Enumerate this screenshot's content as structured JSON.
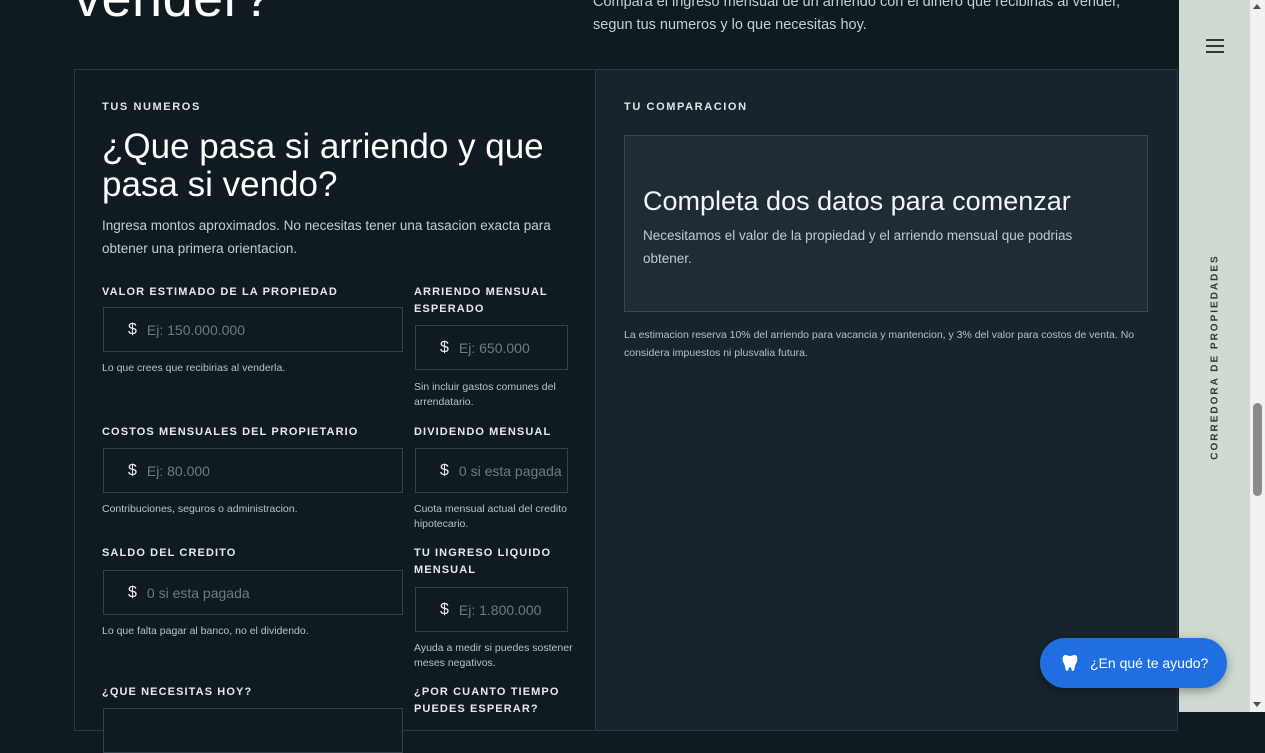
{
  "hero": {
    "title_fragment": "vender?",
    "subtitle": "Compara el ingreso mensual de un arriendo con el dinero que recibirias al vender, segun tus numeros y lo que necesitas hoy."
  },
  "form": {
    "eyebrow": "TUS NUMEROS",
    "title": "¿Que pasa si arriendo y que pasa si vendo?",
    "intro": "Ingresa montos aproximados. No necesitas tener una tasacion exacta para obtener una primera orientacion.",
    "currency_symbol": "$",
    "fields": [
      {
        "label": "VALOR ESTIMADO DE LA PROPIEDAD",
        "placeholder": "Ej: 150.000.000",
        "help": "Lo que crees que recibirias al venderla."
      },
      {
        "label": "ARRIENDO MENSUAL ESPERADO",
        "placeholder": "Ej: 650.000",
        "help": "Sin incluir gastos comunes del arrendatario."
      },
      {
        "label": "COSTOS MENSUALES DEL PROPIETARIO",
        "placeholder": "Ej: 80.000",
        "help": "Contribuciones, seguros o administracion."
      },
      {
        "label": "DIVIDENDO MENSUAL",
        "placeholder": "0 si esta pagada",
        "help": "Cuota mensual actual del credito hipotecario."
      },
      {
        "label": "SALDO DEL CREDITO",
        "placeholder": "0 si esta pagada",
        "help": "Lo que falta pagar al banco, no el dividendo."
      },
      {
        "label": "TU INGRESO LIQUIDO MENSUAL",
        "placeholder": "Ej: 1.800.000",
        "help": "Ayuda a medir si puedes sostener meses negativos."
      },
      {
        "label": "¿QUE NECESITAS HOY?"
      },
      {
        "label": "¿POR CUANTO TIEMPO PUEDES ESPERAR?"
      }
    ]
  },
  "comparison": {
    "eyebrow": "TU COMPARACION",
    "empty_title": "Completa dos datos para comenzar",
    "empty_text": "Necesitamos el valor de la propiedad y el arriendo mensual que podrias obtener.",
    "note": "La estimacion reserva 10% del arriendo para vacancia y mantencion, y 3% del valor para costos de venta. No considera impuestos ni plusvalia futura."
  },
  "sidebar": {
    "menu_icon": "hamburger-icon",
    "vertical_text": "CORREDORA DE PROPIEDADES"
  },
  "chat": {
    "icon": "tooth-icon",
    "label": "¿En qué te ayudo?"
  },
  "colors": {
    "background": "#0f1a21",
    "sidebar": "#cfdad3",
    "chat_button": "#1f6fe0"
  }
}
